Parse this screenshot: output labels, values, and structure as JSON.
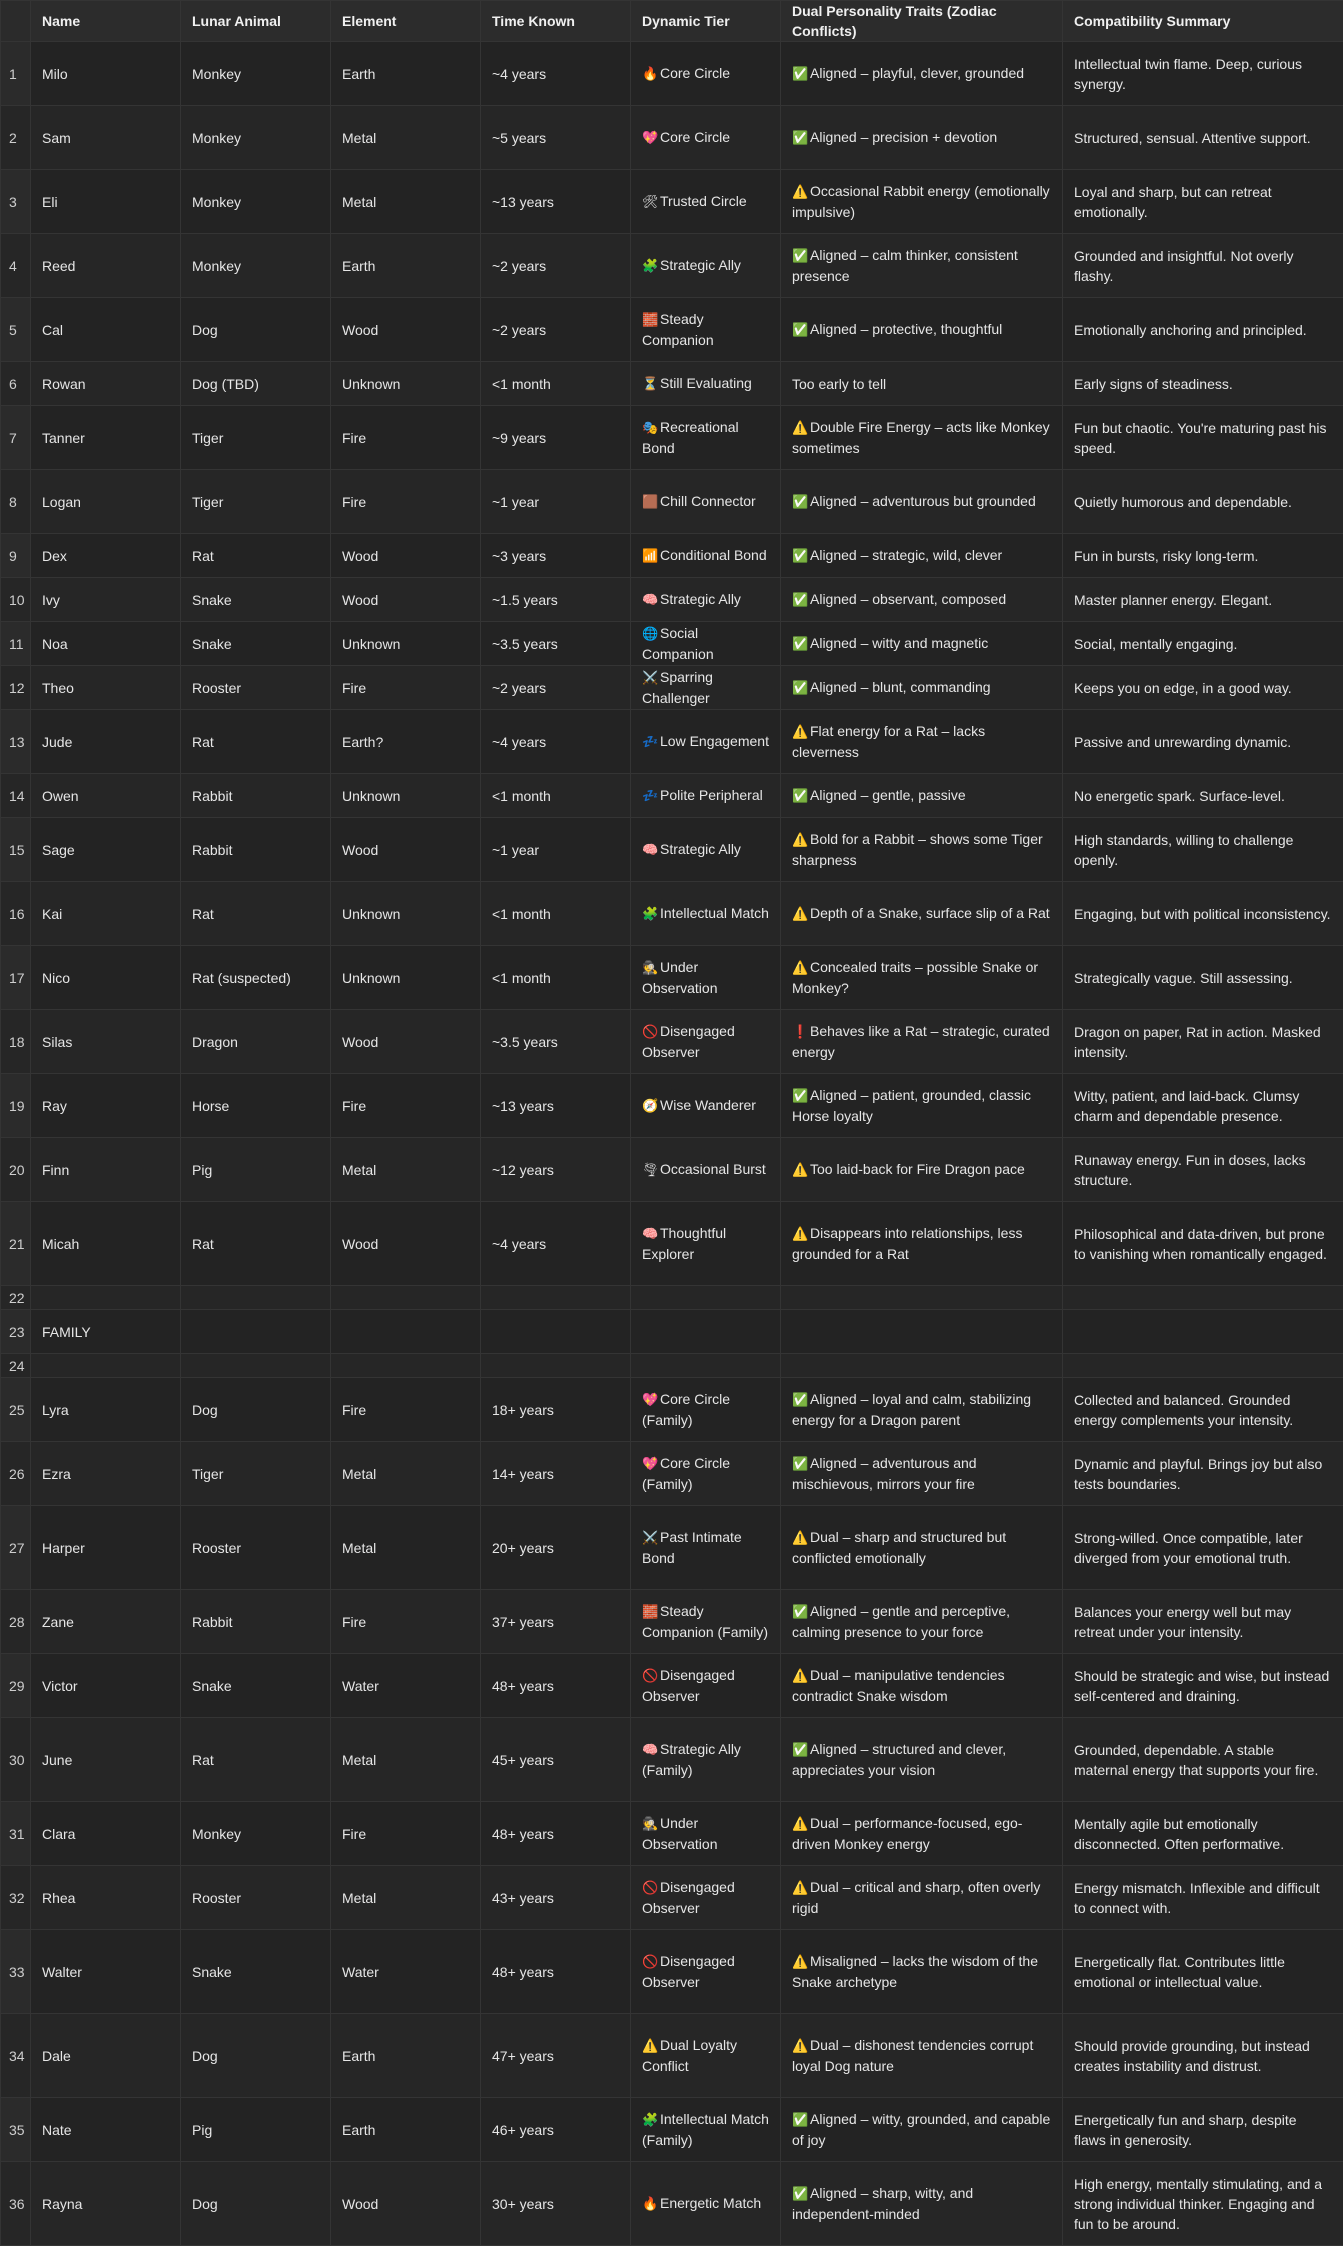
{
  "columns": [
    "Name",
    "Lunar Animal",
    "Element",
    "Time Known",
    "Dynamic Tier",
    "Dual Personality Traits (Zodiac Conflicts)",
    "Compatibility Summary"
  ],
  "rows": [
    {
      "num": "1",
      "name": "Milo",
      "animal": "Monkey",
      "element": "Earth",
      "time": "~4 years",
      "tier_icon": "🔥",
      "tier": "Core Circle",
      "trait_icon": "✅",
      "traits": "Aligned – playful, clever, grounded",
      "summary": "Intellectual twin flame. Deep, curious synergy."
    },
    {
      "num": "2",
      "name": "Sam",
      "animal": "Monkey",
      "element": "Metal",
      "time": "~5 years",
      "tier_icon": "💖",
      "tier": "Core Circle",
      "trait_icon": "✅",
      "traits": "Aligned – precision + devotion",
      "summary": "Structured, sensual. Attentive support."
    },
    {
      "num": "3",
      "name": "Eli",
      "animal": "Monkey",
      "element": "Metal",
      "time": "~13 years",
      "tier_icon": "🛠",
      "tier": "Trusted Circle",
      "trait_icon": "⚠️",
      "traits": "Occasional Rabbit energy (emotionally impulsive)",
      "summary": "Loyal and sharp, but can retreat emotionally."
    },
    {
      "num": "4",
      "name": "Reed",
      "animal": "Monkey",
      "element": "Earth",
      "time": "~2 years",
      "tier_icon": "🧩",
      "tier": "Strategic Ally",
      "trait_icon": "✅",
      "traits": "Aligned – calm thinker, consistent presence",
      "summary": "Grounded and insightful. Not overly flashy."
    },
    {
      "num": "5",
      "name": "Cal",
      "animal": "Dog",
      "element": "Wood",
      "time": "~2 years",
      "tier_icon": "🧱",
      "tier": "Steady Companion",
      "trait_icon": "✅",
      "traits": "Aligned – protective, thoughtful",
      "summary": "Emotionally anchoring and principled."
    },
    {
      "num": "6",
      "name": "Rowan",
      "animal": "Dog (TBD)",
      "element": "Unknown",
      "time": "<1 month",
      "tier_icon": "⏳",
      "tier": "Still Evaluating",
      "trait_icon": "",
      "traits": "Too early to tell",
      "summary": "Early signs of steadiness."
    },
    {
      "num": "7",
      "name": "Tanner",
      "animal": "Tiger",
      "element": "Fire",
      "time": "~9 years",
      "tier_icon": "🎭",
      "tier": "Recreational Bond",
      "trait_icon": "⚠️",
      "traits": "Double Fire Energy – acts like Monkey sometimes",
      "summary": "Fun but chaotic. You're maturing past his speed."
    },
    {
      "num": "8",
      "name": "Logan",
      "animal": "Tiger",
      "element": "Fire",
      "time": "~1 year",
      "tier_icon": "🟫",
      "tier": "Chill Connector",
      "trait_icon": "✅",
      "traits": "Aligned – adventurous but grounded",
      "summary": "Quietly humorous and dependable."
    },
    {
      "num": "9",
      "name": "Dex",
      "animal": "Rat",
      "element": "Wood",
      "time": "~3 years",
      "tier_icon": "📶",
      "tier": "Conditional Bond",
      "trait_icon": "✅",
      "traits": "Aligned – strategic, wild, clever",
      "summary": "Fun in bursts, risky long-term."
    },
    {
      "num": "10",
      "name": "Ivy",
      "animal": "Snake",
      "element": "Wood",
      "time": "~1.5 years",
      "tier_icon": "🧠",
      "tier": "Strategic Ally",
      "trait_icon": "✅",
      "traits": "Aligned – observant, composed",
      "summary": "Master planner energy. Elegant."
    },
    {
      "num": "11",
      "name": "Noa",
      "animal": "Snake",
      "element": "Unknown",
      "time": "~3.5 years",
      "tier_icon": "🌐",
      "tier": "Social Companion",
      "trait_icon": "✅",
      "traits": "Aligned – witty and magnetic",
      "summary": "Social, mentally engaging."
    },
    {
      "num": "12",
      "name": "Theo",
      "animal": "Rooster",
      "element": "Fire",
      "time": "~2 years",
      "tier_icon": "⚔️",
      "tier": "Sparring Challenger",
      "trait_icon": "✅",
      "traits": "Aligned – blunt, commanding",
      "summary": "Keeps you on edge, in a good way."
    },
    {
      "num": "13",
      "name": "Jude",
      "animal": "Rat",
      "element": "Earth?",
      "time": "~4 years",
      "tier_icon": "💤",
      "tier": "Low Engagement",
      "trait_icon": "⚠️",
      "traits": "Flat energy for a Rat – lacks cleverness",
      "summary": "Passive and unrewarding dynamic."
    },
    {
      "num": "14",
      "name": "Owen",
      "animal": "Rabbit",
      "element": "Unknown",
      "time": "<1 month",
      "tier_icon": "💤",
      "tier": "Polite Peripheral",
      "trait_icon": "✅",
      "traits": "Aligned – gentle, passive",
      "summary": "No energetic spark. Surface-level."
    },
    {
      "num": "15",
      "name": "Sage",
      "animal": "Rabbit",
      "element": "Wood",
      "time": "~1 year",
      "tier_icon": "🧠",
      "tier": "Strategic Ally",
      "trait_icon": "⚠️",
      "traits": "Bold for a Rabbit – shows some Tiger sharpness",
      "summary": "High standards, willing to challenge openly."
    },
    {
      "num": "16",
      "name": "Kai",
      "animal": "Rat",
      "element": "Unknown",
      "time": "<1 month",
      "tier_icon": "🧩",
      "tier": "Intellectual Match",
      "trait_icon": "⚠️",
      "traits": "Depth of a Snake, surface slip of a Rat",
      "summary": "Engaging, but with political inconsistency."
    },
    {
      "num": "17",
      "name": "Nico",
      "animal": "Rat (suspected)",
      "element": "Unknown",
      "time": "<1 month",
      "tier_icon": "🕵",
      "tier": "Under Observation",
      "trait_icon": "⚠️",
      "traits": "Concealed traits – possible Snake or Monkey?",
      "summary": "Strategically vague. Still assessing."
    },
    {
      "num": "18",
      "name": "Silas",
      "animal": "Dragon",
      "element": "Wood",
      "time": "~3.5 years",
      "tier_icon": "🚫",
      "tier": "Disengaged Observer",
      "trait_icon": "❗",
      "traits": "Behaves like a Rat – strategic, curated energy",
      "summary": "Dragon on paper, Rat in action. Masked intensity."
    },
    {
      "num": "19",
      "name": "Ray",
      "animal": "Horse",
      "element": "Fire",
      "time": "~13 years",
      "tier_icon": "🧭",
      "tier": "Wise Wanderer",
      "trait_icon": "✅",
      "traits": "Aligned – patient, grounded, classic Horse loyalty",
      "summary": "Witty, patient, and laid-back. Clumsy charm and dependable presence."
    },
    {
      "num": "20",
      "name": "Finn",
      "animal": "Pig",
      "element": "Metal",
      "time": "~12 years",
      "tier_icon": "🌪",
      "tier": "Occasional Burst",
      "trait_icon": "⚠️",
      "traits": "Too laid-back for Fire Dragon pace",
      "summary": "Runaway energy. Fun in doses, lacks structure."
    },
    {
      "num": "21",
      "name": "Micah",
      "animal": "Rat",
      "element": "Wood",
      "time": "~4 years",
      "tier_icon": "🧠",
      "tier": "Thoughtful Explorer",
      "trait_icon": "⚠️",
      "traits": "Disappears into relationships, less grounded for a Rat",
      "summary": "Philosophical and data-driven, but prone to vanishing when romantically engaged."
    },
    {
      "num": "22",
      "name": "",
      "animal": "",
      "element": "",
      "time": "",
      "tier_icon": "",
      "tier": "",
      "trait_icon": "",
      "traits": "",
      "summary": ""
    },
    {
      "num": "23",
      "name": "FAMILY",
      "animal": "",
      "element": "",
      "time": "",
      "tier_icon": "",
      "tier": "",
      "trait_icon": "",
      "traits": "",
      "summary": ""
    },
    {
      "num": "24",
      "name": "",
      "animal": "",
      "element": "",
      "time": "",
      "tier_icon": "",
      "tier": "",
      "trait_icon": "",
      "traits": "",
      "summary": ""
    },
    {
      "num": "25",
      "name": "Lyra",
      "animal": "Dog",
      "element": "Fire",
      "time": "18+ years",
      "tier_icon": "💖",
      "tier": "Core Circle (Family)",
      "trait_icon": "✅",
      "traits": "Aligned – loyal and calm, stabilizing energy for a Dragon parent",
      "summary": "Collected and balanced. Grounded energy complements your intensity."
    },
    {
      "num": "26",
      "name": "Ezra",
      "animal": "Tiger",
      "element": "Metal",
      "time": "14+ years",
      "tier_icon": "💖",
      "tier": "Core Circle (Family)",
      "trait_icon": "✅",
      "traits": "Aligned – adventurous and mischievous, mirrors your fire",
      "summary": "Dynamic and playful. Brings joy but also tests boundaries."
    },
    {
      "num": "27",
      "name": "Harper",
      "animal": "Rooster",
      "element": "Metal",
      "time": "20+ years",
      "tier_icon": "⚔️",
      "tier": "Past Intimate Bond",
      "trait_icon": "⚠️",
      "traits": "Dual – sharp and structured but conflicted emotionally",
      "summary": "Strong-willed. Once compatible, later diverged from your emotional truth."
    },
    {
      "num": "28",
      "name": "Zane",
      "animal": "Rabbit",
      "element": "Fire",
      "time": "37+ years",
      "tier_icon": "🧱",
      "tier": "Steady Companion (Family)",
      "trait_icon": "✅",
      "traits": "Aligned – gentle and perceptive, calming presence to your force",
      "summary": "Balances your energy well but may retreat under your intensity."
    },
    {
      "num": "29",
      "name": "Victor",
      "animal": "Snake",
      "element": "Water",
      "time": "48+ years",
      "tier_icon": "🚫",
      "tier": "Disengaged Observer",
      "trait_icon": "⚠️",
      "traits": "Dual – manipulative tendencies contradict Snake wisdom",
      "summary": "Should be strategic and wise, but instead self-centered and draining."
    },
    {
      "num": "30",
      "name": "June",
      "animal": "Rat",
      "element": "Metal",
      "time": "45+ years",
      "tier_icon": "🧠",
      "tier": "Strategic Ally (Family)",
      "trait_icon": "✅",
      "traits": "Aligned – structured and clever, appreciates your vision",
      "summary": "Grounded, dependable. A stable maternal energy that supports your fire."
    },
    {
      "num": "31",
      "name": "Clara",
      "animal": "Monkey",
      "element": "Fire",
      "time": "48+ years",
      "tier_icon": "🕵",
      "tier": "Under Observation",
      "trait_icon": "⚠️",
      "traits": "Dual – performance-focused, ego-driven Monkey energy",
      "summary": "Mentally agile but emotionally disconnected. Often performative."
    },
    {
      "num": "32",
      "name": "Rhea",
      "animal": "Rooster",
      "element": "Metal",
      "time": "43+ years",
      "tier_icon": "🚫",
      "tier": "Disengaged Observer",
      "trait_icon": "⚠️",
      "traits": "Dual – critical and sharp, often overly rigid",
      "summary": "Energy mismatch. Inflexible and difficult to connect with."
    },
    {
      "num": "33",
      "name": "Walter",
      "animal": "Snake",
      "element": "Water",
      "time": "48+ years",
      "tier_icon": "🚫",
      "tier": "Disengaged Observer",
      "trait_icon": "⚠️",
      "traits": "Misaligned – lacks the wisdom of the Snake archetype",
      "summary": "Energetically flat. Contributes little emotional or intellectual value."
    },
    {
      "num": "34",
      "name": "Dale",
      "animal": "Dog",
      "element": "Earth",
      "time": "47+ years",
      "tier_icon": "⚠️",
      "tier": "Dual Loyalty Conflict",
      "trait_icon": "⚠️",
      "traits": "Dual – dishonest tendencies corrupt loyal Dog nature",
      "summary": "Should provide grounding, but instead creates instability and distrust."
    },
    {
      "num": "35",
      "name": "Nate",
      "animal": "Pig",
      "element": "Earth",
      "time": "46+ years",
      "tier_icon": "🧩",
      "tier": "Intellectual Match (Family)",
      "trait_icon": "✅",
      "traits": "Aligned – witty, grounded, and capable of joy",
      "summary": "Energetically fun and sharp, despite flaws in generosity."
    },
    {
      "num": "36",
      "name": "Rayna",
      "animal": "Dog",
      "element": "Wood",
      "time": "30+ years",
      "tier_icon": "🔥",
      "tier": "Energetic Match",
      "trait_icon": "✅",
      "traits": "Aligned – sharp, witty, and independent-minded",
      "summary": "High energy, mentally stimulating, and a strong individual thinker. Engaging and fun to be around."
    }
  ]
}
